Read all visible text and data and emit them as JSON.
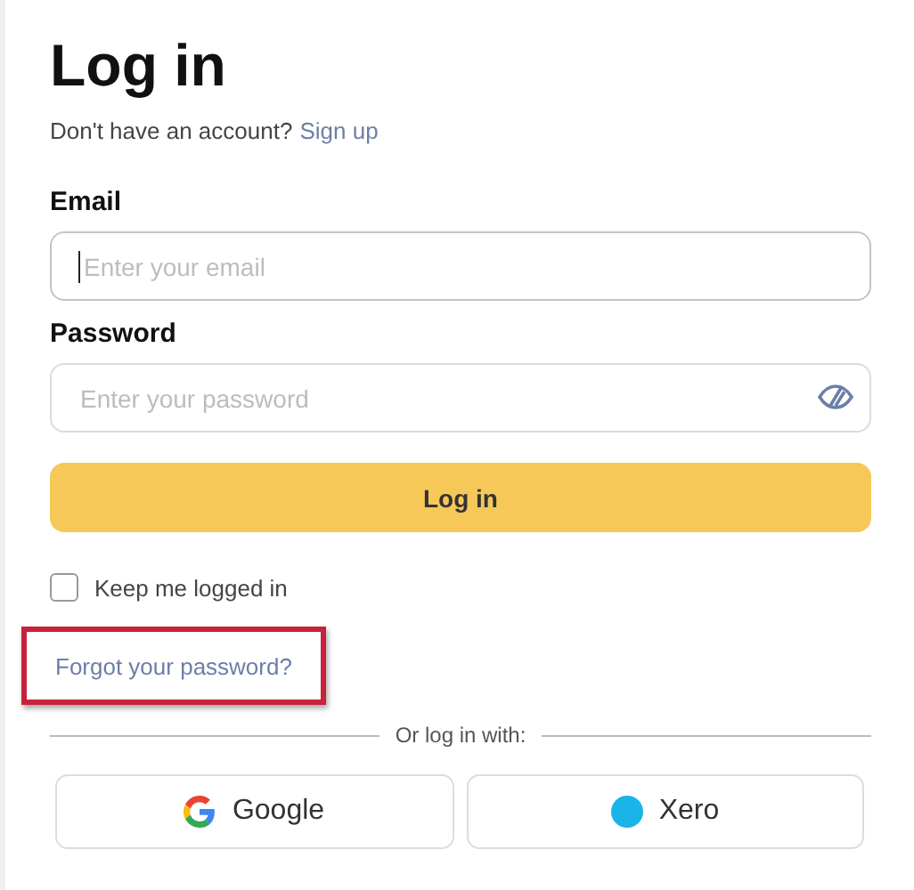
{
  "title": "Log in",
  "signup": {
    "prompt": "Don't have an account?",
    "link": "Sign up"
  },
  "fields": [
    {
      "kind": "email",
      "label": "Email",
      "placeholder": "Enter your email",
      "focused": true
    },
    {
      "kind": "password",
      "label": "Password",
      "placeholder": "Enter your password",
      "focused": false
    }
  ],
  "submit": "Log in",
  "keep_logged_in": {
    "label": "Keep me logged in",
    "checked": false
  },
  "forgot_link": {
    "label": "Forgot your password?",
    "highlighted": true
  },
  "divider": "Or log in with:",
  "providers": [
    {
      "kind": "google",
      "label": "Google"
    },
    {
      "kind": "xero",
      "label": "Xero"
    }
  ]
}
